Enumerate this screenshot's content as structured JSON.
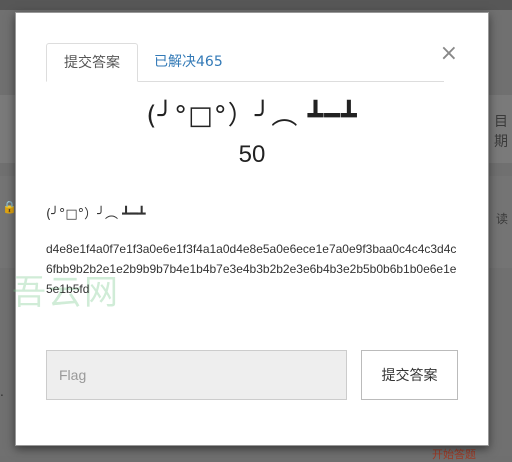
{
  "background": {
    "right_text_1": "目\n期",
    "right_text_2": "读",
    "link_text": "开始答题"
  },
  "modal": {
    "close_label": "×",
    "tabs": [
      {
        "label": "提交答案"
      },
      {
        "label": "已解决465"
      }
    ],
    "title": "(╯°□°）╯︵ ┻━┻",
    "points": "50",
    "description_face": "(╯°□°）╯︵ ┻━┻",
    "cipher": "d4e8e1f4a0f7e1f3a0e6e1f3f4a1a0d4e8e5a0e6ece1e7a0e9f3baa0c4c4c3d4c6fbb9b2b2e1e2b9b9b7b4e1b4b7e3e4b3b2b2e3e6b4b3e2b5b0b6b1b0e6e1e5e1b5fd",
    "watermark": "吾云网",
    "flag_placeholder": "Flag",
    "flag_value": "",
    "submit_label": "提交答案"
  },
  "colors": {
    "overlay": "#707070",
    "tab_link": "#337ab7",
    "input_bg": "#eeeeee"
  }
}
